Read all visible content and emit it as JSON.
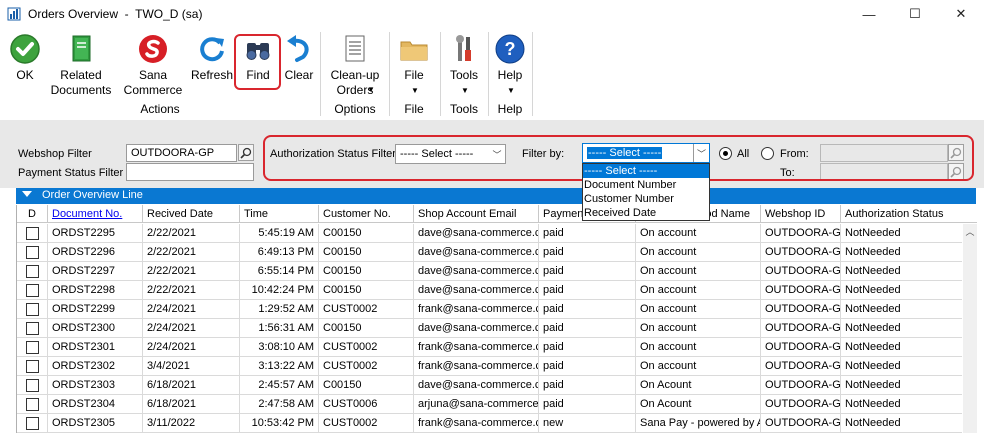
{
  "window": {
    "title": "Orders Overview  -  TWO_D (sa)",
    "controls": {
      "minimize": "—",
      "maximize": "☐",
      "close": "✕"
    }
  },
  "ribbon": {
    "buttons": [
      {
        "id": "ok",
        "label": "OK",
        "icon": "check-circle-icon"
      },
      {
        "id": "related",
        "label": "Related\nDocuments",
        "icon": "book-icon"
      },
      {
        "id": "sana",
        "label": "Sana\nCommerce",
        "icon": "sana-logo-icon"
      },
      {
        "id": "refresh",
        "label": "Refresh",
        "icon": "refresh-icon"
      },
      {
        "id": "find",
        "label": "Find",
        "icon": "binoculars-icon"
      },
      {
        "id": "clear",
        "label": "Clear",
        "icon": "undo-icon"
      },
      {
        "id": "cleanup",
        "label": "Clean-up\nOrders",
        "icon": "document-list-icon"
      },
      {
        "id": "file",
        "label": "File",
        "icon": "folder-icon"
      },
      {
        "id": "tools",
        "label": "Tools",
        "icon": "tools-icon"
      },
      {
        "id": "help",
        "label": "Help",
        "icon": "help-icon"
      }
    ],
    "groups": {
      "actions": "Actions",
      "options": "Options",
      "file": "File",
      "tools": "Tools",
      "help": "Help"
    }
  },
  "filters": {
    "webshop_filter_label": "Webshop Filter",
    "webshop_filter_value": "OUTDOORA-GP",
    "payment_status_label": "Payment Status Filter",
    "payment_status_value": "",
    "auth_status_label": "Authorization Status Filter",
    "auth_status_value": "----- Select -----",
    "filter_by_label": "Filter by:",
    "filter_by_value": "----- Select -----",
    "all_label": "All",
    "from_label": "From:",
    "to_label": "To:",
    "all_selected": true,
    "dropdown_options": [
      "----- Select -----",
      "Document Number",
      "Customer Number",
      "Received Date"
    ],
    "dropdown_selected_index": 0
  },
  "grid": {
    "section_title": "Order Overview Line",
    "columns": [
      "D",
      "Document No.",
      "Recived Date",
      "Time",
      "Customer No.",
      "Shop Account Email",
      "Payment",
      "Payment Method Name",
      "Webshop ID",
      "Authorization Status"
    ],
    "columns_visible": [
      "D",
      "Document No.",
      "Recived Date",
      "Time",
      "Customer No.",
      "Shop Account Email",
      "Paymen",
      "od Name",
      "Webshop ID",
      "Authorization Status"
    ],
    "rows": [
      [
        "ORDST2295",
        "2/22/2021",
        "5:45:19 AM",
        "C00150",
        "dave@sana-commerce.c",
        "paid",
        "On account",
        "OUTDOORA-G",
        "NotNeeded"
      ],
      [
        "ORDST2296",
        "2/22/2021",
        "6:49:13 PM",
        "C00150",
        "dave@sana-commerce.c",
        "paid",
        "On account",
        "OUTDOORA-G",
        "NotNeeded"
      ],
      [
        "ORDST2297",
        "2/22/2021",
        "6:55:14 PM",
        "C00150",
        "dave@sana-commerce.c",
        "paid",
        "On account",
        "OUTDOORA-G",
        "NotNeeded"
      ],
      [
        "ORDST2298",
        "2/22/2021",
        "10:42:24 PM",
        "C00150",
        "dave@sana-commerce.c",
        "paid",
        "On account",
        "OUTDOORA-G",
        "NotNeeded"
      ],
      [
        "ORDST2299",
        "2/24/2021",
        "1:29:52 AM",
        "CUST0002",
        "frank@sana-commerce.c",
        "paid",
        "On account",
        "OUTDOORA-G",
        "NotNeeded"
      ],
      [
        "ORDST2300",
        "2/24/2021",
        "1:56:31 AM",
        "C00150",
        "dave@sana-commerce.c",
        "paid",
        "On account",
        "OUTDOORA-G",
        "NotNeeded"
      ],
      [
        "ORDST2301",
        "2/24/2021",
        "3:08:10 AM",
        "CUST0002",
        "frank@sana-commerce.c",
        "paid",
        "On account",
        "OUTDOORA-G",
        "NotNeeded"
      ],
      [
        "ORDST2302",
        "3/4/2021",
        "3:13:22 AM",
        "CUST0002",
        "frank@sana-commerce.c",
        "paid",
        "On account",
        "OUTDOORA-G",
        "NotNeeded"
      ],
      [
        "ORDST2303",
        "6/18/2021",
        "2:45:57 AM",
        "C00150",
        "dave@sana-commerce.c",
        "paid",
        "On Acount",
        "OUTDOORA-G",
        "NotNeeded"
      ],
      [
        "ORDST2304",
        "6/18/2021",
        "2:47:58 AM",
        "CUST0006",
        "arjuna@sana-commerce.",
        "paid",
        "On Acount",
        "OUTDOORA-G",
        "NotNeeded"
      ],
      [
        "ORDST2305",
        "3/11/2022",
        "10:53:42 PM",
        "CUST0002",
        "frank@sana-commerce.c",
        "new",
        "Sana Pay - powered by A",
        "OUTDOORA-G",
        "NotNeeded"
      ]
    ]
  },
  "colors": {
    "accent": "#0a78d2",
    "highlight": "#d9262e",
    "form_bg": "#e8e8e8"
  }
}
